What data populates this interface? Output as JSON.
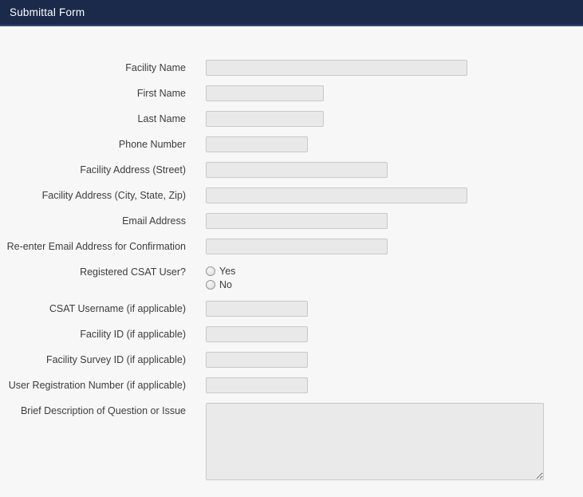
{
  "header": {
    "title": "Submittal Form"
  },
  "colors": {
    "header_bg": "#1b2a4a",
    "header_border": "#2c4a77",
    "page_bg": "#f7f7f7",
    "field_bg": "#e9e9e9",
    "field_border": "#c9c9c9",
    "label_color": "#3d3d3d"
  },
  "form": {
    "fields": [
      {
        "id": "facility_name",
        "label": "Facility Name",
        "type": "text",
        "value": "",
        "placeholder": ""
      },
      {
        "id": "first_name",
        "label": "First Name",
        "type": "text",
        "value": "",
        "placeholder": ""
      },
      {
        "id": "last_name",
        "label": "Last Name",
        "type": "text",
        "value": "",
        "placeholder": ""
      },
      {
        "id": "phone_number",
        "label": "Phone Number",
        "type": "text",
        "value": "",
        "placeholder": ""
      },
      {
        "id": "facility_address_street",
        "label": "Facility Address (Street)",
        "type": "text",
        "value": "",
        "placeholder": ""
      },
      {
        "id": "facility_address_city_state_zip",
        "label": "Facility Address (City, State, Zip)",
        "type": "text",
        "value": "",
        "placeholder": ""
      },
      {
        "id": "email_address",
        "label": "Email Address",
        "type": "text",
        "value": "",
        "placeholder": ""
      },
      {
        "id": "reenter_email_address",
        "label": "Re-enter Email Address for Confirmation",
        "type": "text",
        "value": "",
        "placeholder": ""
      },
      {
        "id": "registered_csat_user",
        "label": "Registered CSAT User?",
        "type": "radio",
        "options": [
          "Yes",
          "No"
        ],
        "selected": ""
      },
      {
        "id": "csat_username",
        "label": "CSAT Username (if applicable)",
        "type": "text",
        "value": "",
        "placeholder": ""
      },
      {
        "id": "facility_id",
        "label": "Facility ID (if applicable)",
        "type": "text",
        "value": "",
        "placeholder": ""
      },
      {
        "id": "facility_survey_id",
        "label": "Facility Survey ID (if applicable)",
        "type": "text",
        "value": "",
        "placeholder": ""
      },
      {
        "id": "user_registration_number",
        "label": "User Registration Number (if applicable)",
        "type": "text",
        "value": "",
        "placeholder": ""
      },
      {
        "id": "brief_description",
        "label": "Brief Description of Question or Issue",
        "type": "textarea",
        "value": "",
        "placeholder": ""
      }
    ]
  }
}
